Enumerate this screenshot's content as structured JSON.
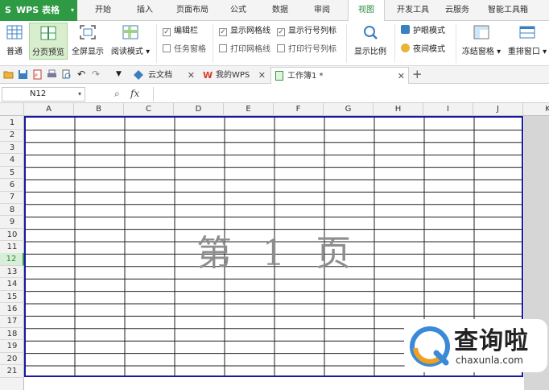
{
  "app": {
    "title": "WPS 表格"
  },
  "ribbon_tabs": [
    "开始",
    "插入",
    "页面布局",
    "公式",
    "数据",
    "审阅",
    "视图",
    "开发工具",
    "云服务",
    "智能工具箱"
  ],
  "active_tab": "视图",
  "ribbon": {
    "normal": "普通",
    "page_break_preview": "分页预览",
    "fullscreen": "全屏显示",
    "reading_mode": "阅读模式",
    "edit_bar": "编辑栏",
    "task_pane": "任务窗格",
    "show_gridlines": "显示网格线",
    "print_gridlines": "打印网格线",
    "show_row_col_headers": "显示行号列标",
    "print_row_col_headers": "打印行号列标",
    "zoom": "显示比例",
    "eye_protection": "护眼模式",
    "night_mode": "夜间模式",
    "freeze_panes": "冻结窗格",
    "rearrange_windows": "重排窗口"
  },
  "checkboxes": {
    "edit_bar": true,
    "task_pane": false,
    "show_gridlines": true,
    "print_gridlines": false,
    "show_row_col_headers": true,
    "print_row_col_headers": false
  },
  "doc_tabs": [
    {
      "label": "云文档"
    },
    {
      "label": "我的WPS"
    },
    {
      "label": "工作簿1 *"
    }
  ],
  "formula_bar": {
    "name_box": "N12",
    "fx": "fx"
  },
  "columns": [
    "A",
    "B",
    "C",
    "D",
    "E",
    "F",
    "G",
    "H",
    "I",
    "J",
    "K"
  ],
  "rows": [
    "1",
    "2",
    "3",
    "4",
    "5",
    "6",
    "7",
    "8",
    "9",
    "10",
    "11",
    "12",
    "13",
    "14",
    "15",
    "16",
    "17",
    "18",
    "19",
    "20",
    "21"
  ],
  "current_row": "12",
  "page_watermark": "第 1 页",
  "badge": {
    "brand": "查询啦",
    "url": "chaxunla.com"
  },
  "colors": {
    "accent": "#2e9a44",
    "page_border": "#1a1aa0"
  }
}
